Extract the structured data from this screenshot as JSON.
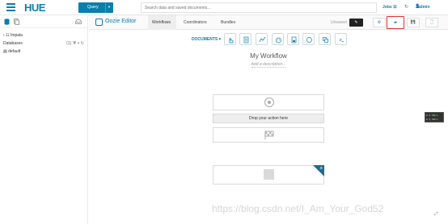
{
  "app": {
    "logo": "HUE",
    "query_button": "Query",
    "search_placeholder": "Search data and saved documents...",
    "jobs_label": "Jobs",
    "user_label": "admin"
  },
  "left_panel": {
    "source_label": "Impala",
    "databases_label": "Databases",
    "databases_count": "(1)",
    "database_items": [
      "default"
    ]
  },
  "editor": {
    "title": "Oozie Editor",
    "tabs": [
      {
        "label": "Workflows",
        "active": true
      },
      {
        "label": "Coordinators",
        "active": false
      },
      {
        "label": "Bundles",
        "active": false
      }
    ],
    "status": "Unsaved"
  },
  "canvas": {
    "documents_label": "DOCUMENTS",
    "workflow_name": "My Workflow",
    "description_placeholder": "Add a description...",
    "drop_zone_label": "Drop your action here"
  },
  "float_widget": {
    "line1": "0.1 KB/s",
    "line2": "0.1 KB/s"
  },
  "watermark": "https://blog.csdn.net/I_Am_Your_God52"
}
